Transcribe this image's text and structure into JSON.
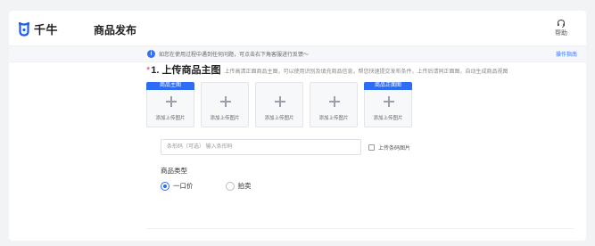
{
  "app": {
    "logo_text": "千牛",
    "page_title": "商品发布",
    "help_label": "帮助"
  },
  "notice": {
    "text": "如您在使用过程中遇到任何问题，可点击右下角客服进行反馈～",
    "link": "操作指南"
  },
  "section": {
    "required_mark": "*",
    "title": "1. 上传商品主图",
    "subtitle": "上传高清正面商品主图，可以使用识别及填充商品信息，帮您快速提交发布条件，上传后请同正面图，自动生成商品视图"
  },
  "tiles": [
    {
      "tag": "商品主图",
      "label": "添加上传图片"
    },
    {
      "tag": "",
      "label": "添加上传图片"
    },
    {
      "tag": "",
      "label": "添加上传图片"
    },
    {
      "tag": "",
      "label": "添加上传图片"
    },
    {
      "tag": "商品正面图",
      "label": "添加上传图片"
    }
  ],
  "barcode": {
    "placeholder": "条形码（可选） 输入条形码",
    "checkbox_label": "上传条码图片"
  },
  "product_type": {
    "label": "商品类型",
    "options": [
      {
        "label": "一口价",
        "selected": true
      },
      {
        "label": "拍卖",
        "selected": false
      }
    ]
  },
  "colors": {
    "accent": "#2d6df5",
    "required": "#e34d59"
  }
}
